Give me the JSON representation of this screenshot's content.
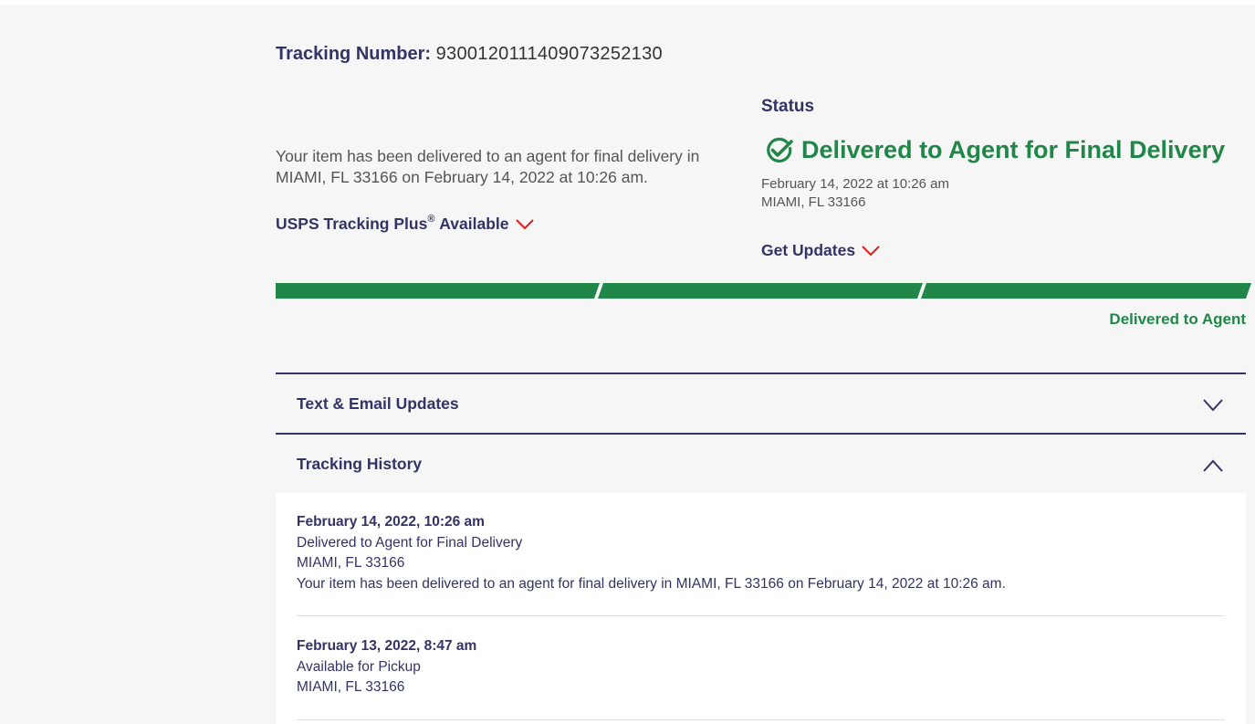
{
  "tracking": {
    "label": "Tracking Number:",
    "number": "9300120111409073252130"
  },
  "summary_text": "Your item has been delivered to an agent for final delivery in MIAMI, FL 33166 on February 14, 2022 at 10:26 am.",
  "tracking_plus": {
    "label": "USPS Tracking Plus",
    "registered": "®",
    "suffix": "Available"
  },
  "status": {
    "heading": "Status",
    "main": "Delivered to Agent for Final Delivery",
    "date": "February 14, 2022 at 10:26 am",
    "location": "MIAMI, FL 33166",
    "get_updates": "Get Updates"
  },
  "progress": {
    "completed_segments": 3,
    "total_segments": 3,
    "label": "Delivered to Agent"
  },
  "accordions": {
    "text_email": "Text & Email Updates",
    "history": "Tracking History"
  },
  "history": [
    {
      "date": "February 14, 2022, 10:26 am",
      "status": "Delivered to Agent for Final Delivery",
      "location": "MIAMI, FL 33166",
      "detail": "Your item has been delivered to an agent for final delivery in MIAMI, FL 33166 on February 14, 2022 at 10:26 am."
    },
    {
      "date": "February 13, 2022, 8:47 am",
      "status": "Available for Pickup",
      "location": "MIAMI, FL 33166"
    }
  ],
  "colors": {
    "navy": "#333366",
    "green": "#218748",
    "red": "#e71921"
  }
}
